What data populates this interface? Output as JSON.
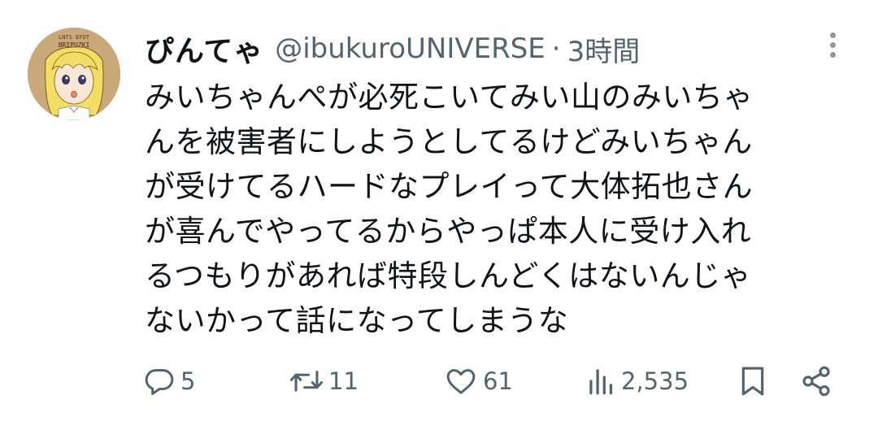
{
  "tweet": {
    "display_name": "ぴんてゃ",
    "handle": "@ibukuroUNIVERSE",
    "separator": "·",
    "time": "3時間",
    "lines": [
      "みいちゃんぺが必死こいてみい山のみいちゃ",
      "んを被害者にしようとしてるけどみいちゃん",
      "が受けてるハードなプレイって大体拓也さん",
      "が喜んでやってるからやっぱ本人に受け入れ",
      "るつもりがあれば特段しんどくはないんじゃ",
      "ないかって話になってしまうな"
    ],
    "avatar_text": "BRIPUZKI"
  },
  "actions": {
    "replies": "5",
    "retweets": "11",
    "likes": "61",
    "views": "2,535"
  },
  "icons": {
    "reply": "reply-bubble-icon",
    "retweet": "retweet-icon",
    "like": "heart-icon",
    "views": "views-bar-chart-icon",
    "bookmark": "bookmark-icon",
    "share": "share-icon",
    "more": "more-vertical-icon"
  },
  "colors": {
    "text": "#0f1419",
    "secondary": "#536471"
  }
}
